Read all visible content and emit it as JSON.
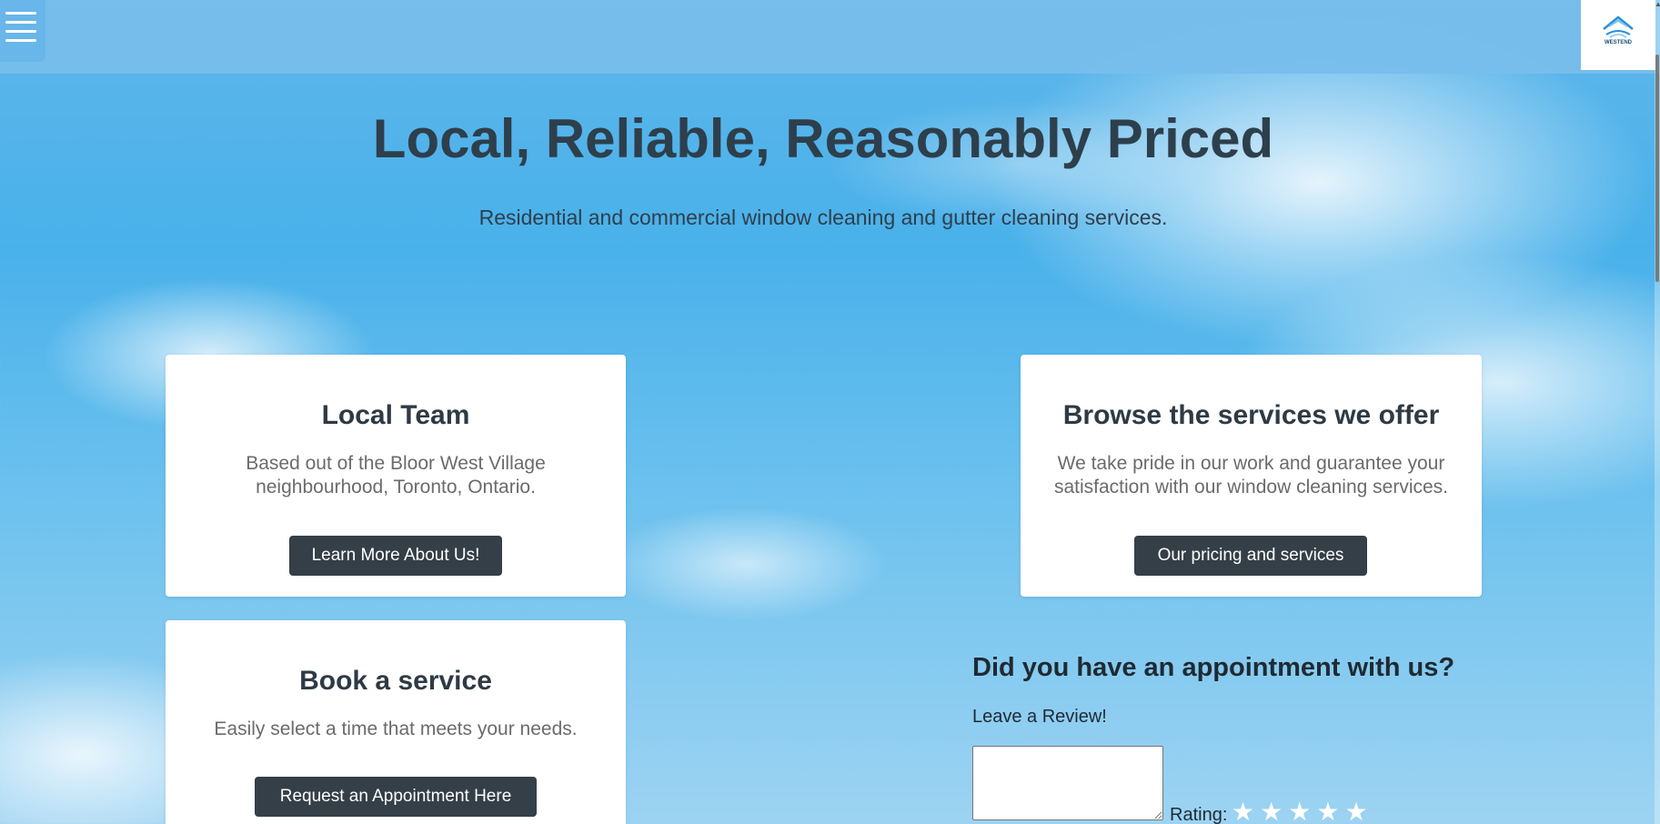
{
  "header": {
    "menu_icon": "hamburger-icon",
    "logo_icon": "house-roof-logo-icon",
    "logo_text": "WESTEND"
  },
  "hero": {
    "title": "Local, Reliable, Reasonably Priced",
    "subtitle": "Residential and commercial window cleaning and gutter cleaning services."
  },
  "cards": {
    "local_team": {
      "title": "Local Team",
      "text": "Based out of the Bloor West Village neighbourhood, Toronto, Ontario.",
      "button": "Learn More About Us!"
    },
    "services": {
      "title": "Browse the services we offer",
      "text": "We take pride in our work and guarantee your satisfaction with our window cleaning services.",
      "button": "Our pricing and services"
    },
    "book": {
      "title": "Book a service",
      "text": "Easily select a time that meets your needs.",
      "button": "Request an Appointment Here"
    }
  },
  "review": {
    "title": "Did you have an appointment with us?",
    "label": "Leave a Review!",
    "textarea_value": "",
    "rating_label": "Rating:",
    "stars": [
      "★",
      "★",
      "★",
      "★",
      "★"
    ],
    "stars_selected": 0
  },
  "colors": {
    "header_bg": "#78beec",
    "button_bg": "#343f48",
    "heading_text": "#2e3f4c",
    "body_text": "#6b6b6b"
  }
}
